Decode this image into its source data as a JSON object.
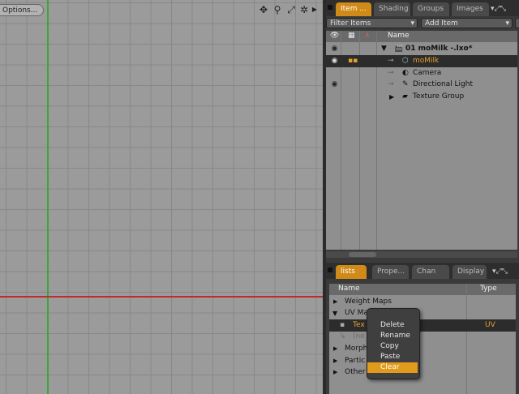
{
  "viewport": {
    "options_label": "Options..."
  },
  "item_panel": {
    "tabs": [
      "Item ...",
      "Shading",
      "Groups",
      "Images"
    ],
    "filter_label": "Filter Items",
    "add_label": "Add Item",
    "column_name": "Name",
    "items": [
      {
        "label": "01 moMilk -.lxo*",
        "icon": "scene-icon",
        "selected": false
      },
      {
        "label": "moMilk",
        "icon": "mesh-icon",
        "selected": true
      },
      {
        "label": "Camera",
        "icon": "camera-icon",
        "selected": false
      },
      {
        "label": "Directional Light",
        "icon": "light-icon",
        "selected": false
      },
      {
        "label": "Texture Group",
        "icon": "texture-group-icon",
        "selected": false
      }
    ]
  },
  "lists_panel": {
    "tabs": [
      "lists",
      "Prope...",
      "Chan ...",
      "Display"
    ],
    "col_name": "Name",
    "col_type": "Type",
    "rows": [
      {
        "label": "Weight Maps",
        "type": ""
      },
      {
        "label": "UV Ma",
        "type": ""
      },
      {
        "label": "Tex",
        "type": "UV"
      },
      {
        "label": "(ne",
        "type": ""
      },
      {
        "label": "Morph",
        "type": ""
      },
      {
        "label": "Partic",
        "type": ""
      },
      {
        "label": "Other",
        "type": ""
      }
    ]
  },
  "context_menu": {
    "items": [
      "Delete",
      "Rename",
      "Copy",
      "Paste",
      "Clear"
    ],
    "highlighted": "Clear"
  },
  "colors": {
    "accent": "#d08a18",
    "viewport_bg": "#9b9b9b",
    "axis_y": "#38a838",
    "axis_x": "#c02a2a"
  }
}
